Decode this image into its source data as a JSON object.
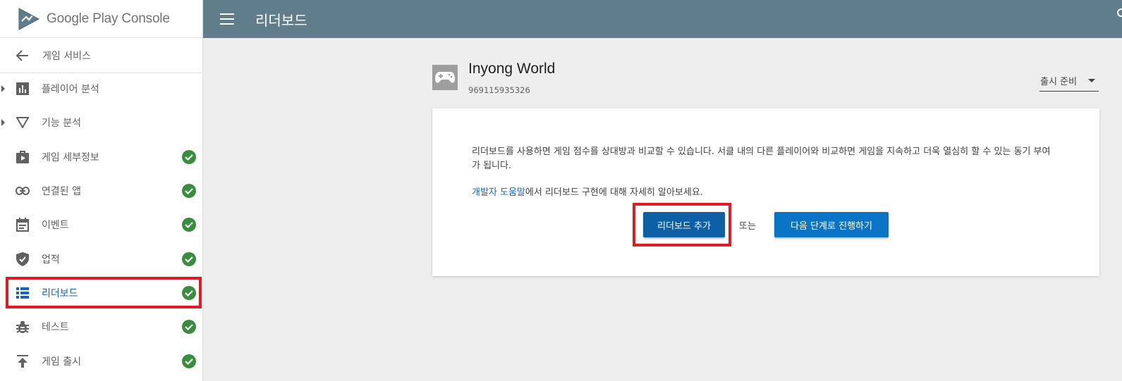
{
  "brand": {
    "name": "Google Play Console"
  },
  "header": {
    "title": "리더보드"
  },
  "back": {
    "label": "게임 서비스"
  },
  "sidebar": {
    "items": [
      {
        "label": "플레이어 분석",
        "icon": "bar-chart-icon",
        "expandable": true,
        "complete": false
      },
      {
        "label": "기능 분석",
        "icon": "funnel-icon",
        "expandable": true,
        "complete": false
      },
      {
        "label": "게임 세부정보",
        "icon": "play-bag-icon",
        "complete": true
      },
      {
        "label": "연결된 앱",
        "icon": "link-icon",
        "complete": true
      },
      {
        "label": "이벤트",
        "icon": "calendar-icon",
        "complete": true
      },
      {
        "label": "업적",
        "icon": "shield-check-icon",
        "complete": true
      },
      {
        "label": "리더보드",
        "icon": "list-icon",
        "complete": true,
        "active": true
      },
      {
        "label": "테스트",
        "icon": "bug-icon",
        "complete": true
      },
      {
        "label": "게임 출시",
        "icon": "publish-icon",
        "complete": true
      }
    ]
  },
  "app": {
    "name": "Inyong World",
    "id": "969115935326",
    "status": "출시 준비"
  },
  "card": {
    "description": "리더보드를 사용하면 게임 점수를 상대방과 비교할 수 있습니다. 서클 내의 다른 플레이어와 비교하면 게임을 지속하고 더욱 열심히 할 수 있는 동기 부여가 됩니다.",
    "help_link": "개발자 도움말",
    "help_rest": "에서 리더보드 구현에 대해 자세히 알아보세요.",
    "add_button": "리더보드 추가",
    "or": "또는",
    "next_button": "다음 단계로 진행하기"
  },
  "colors": {
    "topbar": "#607d8b",
    "primary": "#0a74c7",
    "check": "#388e3c",
    "highlight": "#e01b24",
    "link": "#1565c0"
  }
}
